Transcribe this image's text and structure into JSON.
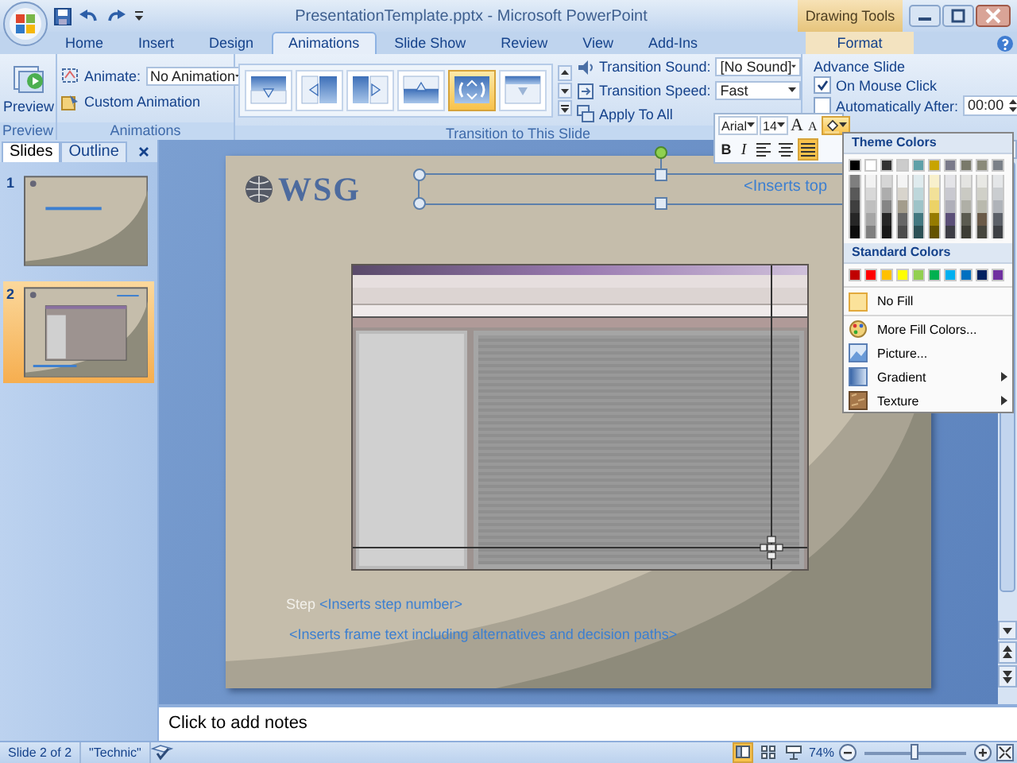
{
  "window": {
    "title": "PresentationTemplate.pptx - Microsoft PowerPoint",
    "context_label": "Drawing Tools"
  },
  "tabs": [
    {
      "label": "Home",
      "selected": false,
      "contextual": false
    },
    {
      "label": "Insert",
      "selected": false,
      "contextual": false
    },
    {
      "label": "Design",
      "selected": false,
      "contextual": false
    },
    {
      "label": "Animations",
      "selected": true,
      "contextual": false
    },
    {
      "label": "Slide Show",
      "selected": false,
      "contextual": false
    },
    {
      "label": "Review",
      "selected": false,
      "contextual": false
    },
    {
      "label": "View",
      "selected": false,
      "contextual": false
    },
    {
      "label": "Add-Ins",
      "selected": false,
      "contextual": false
    },
    {
      "label": "Format",
      "selected": false,
      "contextual": true
    }
  ],
  "preview_group": {
    "button": "Preview",
    "label": "Preview"
  },
  "animations_group": {
    "animate_label": "Animate:",
    "animate_value": "No Animation",
    "custom_button": "Custom Animation",
    "label": "Animations"
  },
  "transition_group": {
    "effects": [
      {
        "kind": "down",
        "selected": false
      },
      {
        "kind": "left",
        "selected": false
      },
      {
        "kind": "right",
        "selected": false
      },
      {
        "kind": "up",
        "selected": false
      },
      {
        "kind": "wheel",
        "selected": true
      },
      {
        "kind": "cover-down",
        "selected": false
      }
    ],
    "sound_label": "Transition Sound:",
    "sound_value": "[No Sound]",
    "speed_label": "Transition Speed:",
    "speed_value": "Fast",
    "apply_button": "Apply To All",
    "label": "Transition to This Slide"
  },
  "advance_group": {
    "title": "Advance Slide",
    "options": [
      {
        "label": "On Mouse Click",
        "checked": true
      },
      {
        "label": "Automatically After:",
        "checked": false,
        "value": "00:00"
      }
    ]
  },
  "mini_toolbar": {
    "font": "Arial",
    "size": "14",
    "grow": "A",
    "shrink": "A",
    "bold": "B",
    "italic": "I",
    "alignments": [
      {
        "kind": "left",
        "selected": false
      },
      {
        "kind": "center",
        "selected": false
      },
      {
        "kind": "justify",
        "selected": true
      }
    ]
  },
  "fill_menu": {
    "theme_title": "Theme Colors",
    "theme_colors": [
      {
        "color": "#000000",
        "shades": [
          {
            "color": "#7f7f7f"
          },
          {
            "color": "#595959"
          },
          {
            "color": "#3f3f3f"
          },
          {
            "color": "#262626"
          },
          {
            "color": "#0c0c0c"
          }
        ]
      },
      {
        "color": "#ffffff",
        "shades": [
          {
            "color": "#f2f2f2"
          },
          {
            "color": "#d8d8d8"
          },
          {
            "color": "#bfbfbf"
          },
          {
            "color": "#a5a5a5"
          },
          {
            "color": "#7f7f7f"
          }
        ]
      },
      {
        "color": "#333333",
        "shades": [
          {
            "color": "#d6d6d6"
          },
          {
            "color": "#adadad"
          },
          {
            "color": "#858585"
          },
          {
            "color": "#262626"
          },
          {
            "color": "#191919"
          }
        ]
      },
      {
        "color": "#cccccc",
        "shades": [
          {
            "color": "#f4f4f4"
          },
          {
            "color": "#d8d4cc"
          },
          {
            "color": "#a39c8c"
          },
          {
            "color": "#666666"
          },
          {
            "color": "#4c4c4c"
          }
        ]
      },
      {
        "color": "#5fa0a8",
        "shades": [
          {
            "color": "#dfebee"
          },
          {
            "color": "#bed7db"
          },
          {
            "color": "#9ec3c8"
          },
          {
            "color": "#437880"
          },
          {
            "color": "#2c5055"
          }
        ]
      },
      {
        "color": "#c8a400",
        "shades": [
          {
            "color": "#f8f0cc"
          },
          {
            "color": "#f2e199"
          },
          {
            "color": "#ecd266"
          },
          {
            "color": "#967b00"
          },
          {
            "color": "#645200"
          }
        ]
      },
      {
        "color": "#7a7a8a",
        "shades": [
          {
            "color": "#e4e4e8"
          },
          {
            "color": "#c9c9d0"
          },
          {
            "color": "#afafb9"
          },
          {
            "color": "#5b4f78"
          },
          {
            "color": "#3d3d45"
          }
        ]
      },
      {
        "color": "#7a7a6a",
        "shades": [
          {
            "color": "#e4e4e1"
          },
          {
            "color": "#cacac3"
          },
          {
            "color": "#afafa6"
          },
          {
            "color": "#5b5b50"
          },
          {
            "color": "#3d3d35"
          }
        ]
      },
      {
        "color": "#8a8a7a",
        "shades": [
          {
            "color": "#e8e8e4"
          },
          {
            "color": "#d0d0c8"
          },
          {
            "color": "#b9b9ad"
          },
          {
            "color": "#6a5a48"
          },
          {
            "color": "#45453d"
          }
        ]
      },
      {
        "color": "#7a8088",
        "shades": [
          {
            "color": "#e4e6e8"
          },
          {
            "color": "#cacdd0"
          },
          {
            "color": "#afb3b9"
          },
          {
            "color": "#5b6068"
          },
          {
            "color": "#3d4045"
          }
        ]
      }
    ],
    "standard_title": "Standard Colors",
    "standard_colors": [
      {
        "color": "#c00000"
      },
      {
        "color": "#ff0000"
      },
      {
        "color": "#ffc000"
      },
      {
        "color": "#ffff00"
      },
      {
        "color": "#92d050"
      },
      {
        "color": "#00b050"
      },
      {
        "color": "#00b0f0"
      },
      {
        "color": "#0070c0"
      },
      {
        "color": "#002060"
      },
      {
        "color": "#7030a0"
      }
    ],
    "items": [
      {
        "label": "No Fill",
        "kind": "no-fill",
        "submenu": false
      },
      {
        "label": "More Fill Colors...",
        "kind": "palette",
        "submenu": false
      },
      {
        "label": "Picture...",
        "kind": "picture",
        "submenu": false
      },
      {
        "label": "Gradient",
        "kind": "gradient",
        "submenu": true
      },
      {
        "label": "Texture",
        "kind": "texture",
        "submenu": true
      }
    ]
  },
  "slides_pane": {
    "tabs": [
      {
        "label": "Slides",
        "selected": true
      },
      {
        "label": "Outline",
        "selected": false
      }
    ],
    "thumbnails": [
      {
        "number": "1",
        "kind": "title-slide",
        "selected": false
      },
      {
        "number": "2",
        "kind": "content-slide",
        "selected": true
      }
    ]
  },
  "slide": {
    "logo": "WSG",
    "title_placeholder": "<Inserts top",
    "step_label": "Step",
    "step_value": "<Inserts step number>",
    "frame_text": "<Inserts frame text including alternatives and decision paths>"
  },
  "notes": {
    "placeholder": "Click to add notes"
  },
  "status_bar": {
    "slide": "Slide 2 of 2",
    "theme": "\"Technic\"",
    "views": [
      {
        "kind": "normal",
        "selected": true
      },
      {
        "kind": "sorter",
        "selected": false
      },
      {
        "kind": "show",
        "selected": false
      }
    ],
    "zoom": "74%",
    "zoom_slider": {
      "level": 0.5
    }
  }
}
